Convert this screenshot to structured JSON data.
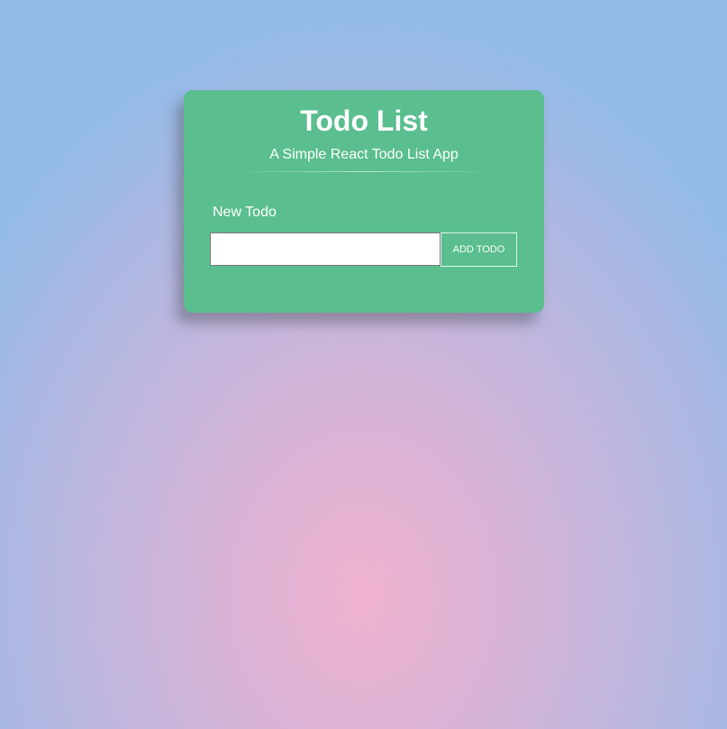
{
  "app": {
    "title": "Todo List",
    "subtitle": "A Simple React Todo List App"
  },
  "form": {
    "label": "New Todo",
    "input_value": "",
    "input_placeholder": "",
    "button_label": "ADD TODO"
  },
  "colors": {
    "card_background": "#5abe8f",
    "text": "#ffffff",
    "background_center": "#f0b2cf",
    "background_edge": "#93bbe8"
  }
}
